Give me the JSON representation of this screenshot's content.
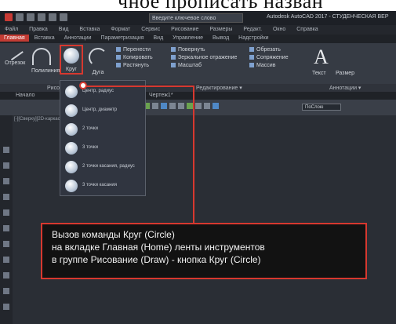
{
  "caption": "чное прописать назван",
  "titlebar": {
    "search": "Введите ключевое слово",
    "app_title": "Autodesk AutoCAD 2017 - СТУДЕНЧЕСКАЯ ВЕР"
  },
  "menu": [
    "Файл",
    "Правка",
    "Вид",
    "Вставка",
    "Формат",
    "Сервис",
    "Рисование",
    "Размеры",
    "Редакт.",
    "Окно",
    "Справка"
  ],
  "ribbon_tabs": [
    "Главная",
    "Вставка",
    "Аннотации",
    "Параметризация",
    "Вид",
    "Управление",
    "Вывод",
    "Надстройки"
  ],
  "ribbon": {
    "buttons": [
      "Отрезок",
      "Полилиния",
      "Круг",
      "Дуга"
    ],
    "modify_col": [
      "Перенести",
      "Копировать",
      "Растянуть"
    ],
    "modify_col2": [
      "Повернуть",
      "Зеркальное отражение",
      "Масштаб"
    ],
    "modify_col3": [
      "Обрезать",
      "Сопряжение",
      "Массив"
    ],
    "text_label": "Текст",
    "text_glyph": "A",
    "size_label": "Размер",
    "footer_draw": "Рисование ▾",
    "footer_modify": "Редактирование ▾",
    "footer_annot": "Аннотации ▾"
  },
  "doc_tabs": {
    "start": "Начало",
    "drawing": "Чертеж1*"
  },
  "layer_box": "ПоСлою",
  "canvas_label": "[-][Сверху][2D-каркас]",
  "dropdown_items": [
    "Центр, радиус",
    "Центр, диаметр",
    "2 точки",
    "3 точки",
    "2 точки касания, радиус",
    "3 точки касания"
  ],
  "callout": {
    "line1": "Вызов команды Круг (Circle)",
    "line2": "на вкладке Главная (Home) ленты инструментов",
    "line3": "в группе Рисование (Draw) - кнопка Круг (Circle)"
  }
}
